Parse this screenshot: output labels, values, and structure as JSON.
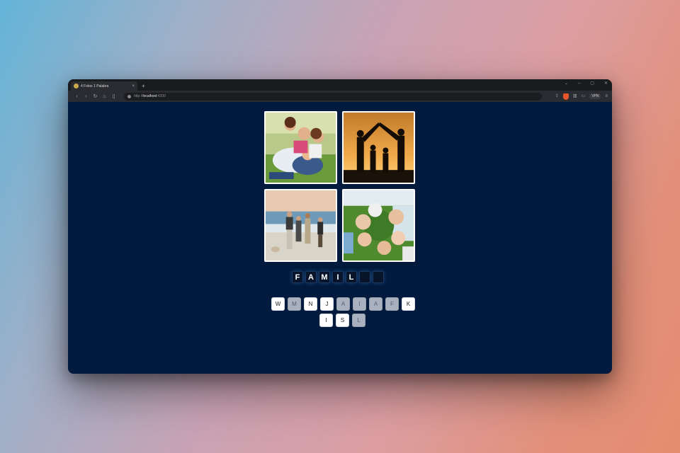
{
  "browser": {
    "tab_title": "4 Fotos 1 Palabra",
    "tab_close": "×",
    "new_tab": "+",
    "url_scheme": "http://",
    "url_host": "localhost",
    "url_port": ":4200",
    "vpn_label": "VPN",
    "window_controls": [
      "⌄",
      "–",
      "▢",
      "✕"
    ]
  },
  "game": {
    "photos": [
      {
        "subject": "family-on-grass"
      },
      {
        "subject": "family-silhouette-sunset"
      },
      {
        "subject": "family-on-beach"
      },
      {
        "subject": "kids-lying-in-circle"
      }
    ],
    "answer_slots": [
      "F",
      "A",
      "M",
      "I",
      "L",
      "",
      ""
    ],
    "letters_row1": [
      {
        "letter": "W",
        "used": false
      },
      {
        "letter": "M",
        "used": true
      },
      {
        "letter": "N",
        "used": false
      },
      {
        "letter": "J",
        "used": false
      },
      {
        "letter": "A",
        "used": true
      },
      {
        "letter": "I",
        "used": true
      },
      {
        "letter": "A",
        "used": true
      },
      {
        "letter": "F",
        "used": true
      },
      {
        "letter": "K",
        "used": false
      }
    ],
    "letters_row2": [
      {
        "letter": "I",
        "used": false
      },
      {
        "letter": "S",
        "used": false
      },
      {
        "letter": "L",
        "used": true
      }
    ]
  },
  "colors": {
    "page_background": "#011a3d",
    "used_key": "#a8b1bd"
  }
}
